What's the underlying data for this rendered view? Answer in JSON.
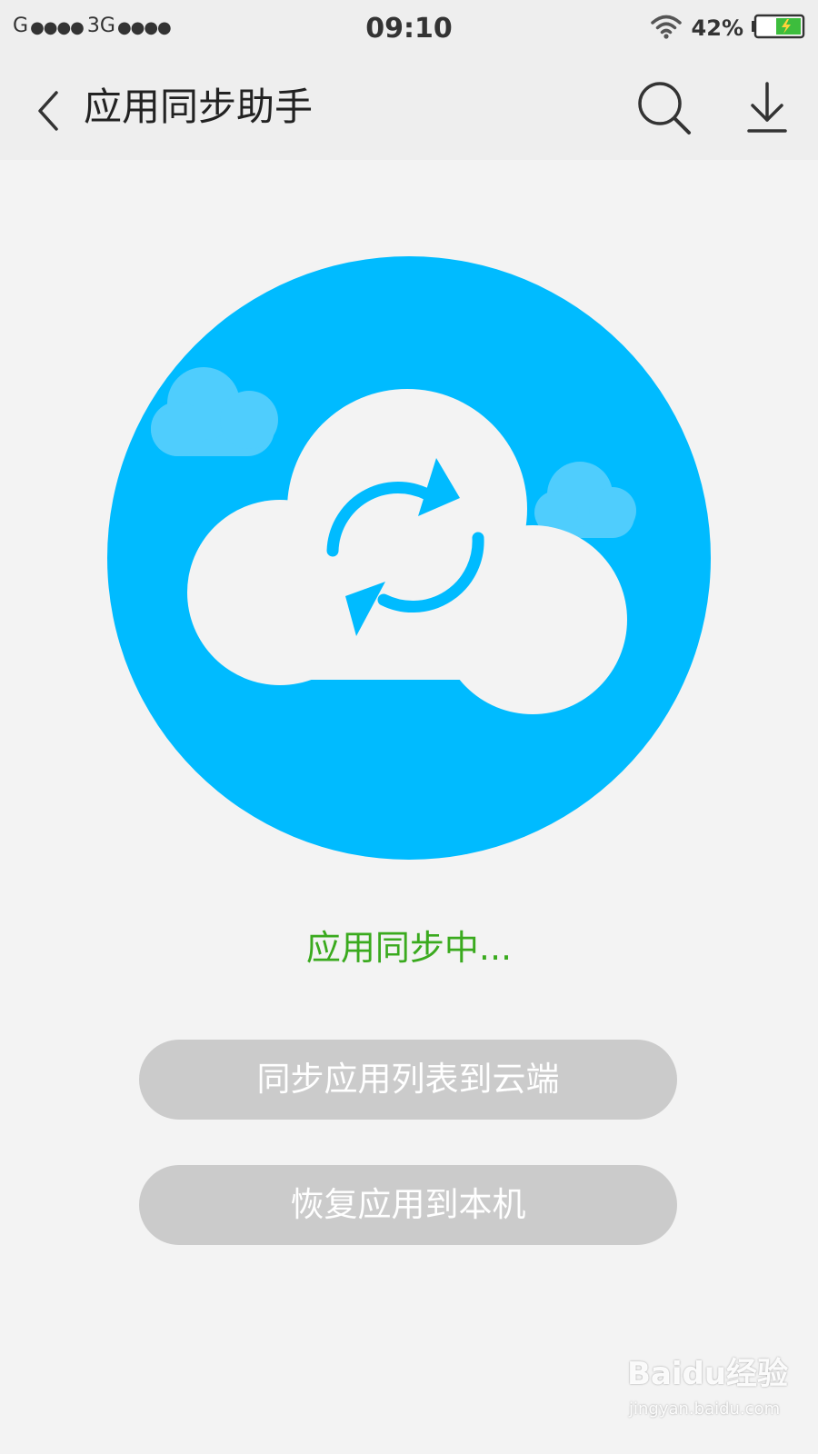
{
  "status_bar": {
    "carrier1": "G",
    "carrier2": "3G",
    "signal_dots": "●●●●",
    "time": "09:10",
    "battery_percent": "42%",
    "icons": [
      "signal-icon",
      "wifi-icon",
      "battery-charging-icon"
    ]
  },
  "nav": {
    "title": "应用同步助手",
    "icons": [
      "back-icon",
      "search-icon",
      "download-icon"
    ]
  },
  "hero": {
    "icon": "cloud-sync-icon",
    "circle_color": "#00bbff"
  },
  "sync_status": "应用同步中...",
  "buttons": {
    "sync_to_cloud": "同步应用列表到云端",
    "restore_to_device": "恢复应用到本机"
  },
  "watermark": {
    "brand": "Baidu经验",
    "url": "jingyan.baidu.com"
  },
  "colors": {
    "status_text": "#3aaa1e",
    "button_bg": "#cbcbcb",
    "accent": "#00bbff"
  }
}
